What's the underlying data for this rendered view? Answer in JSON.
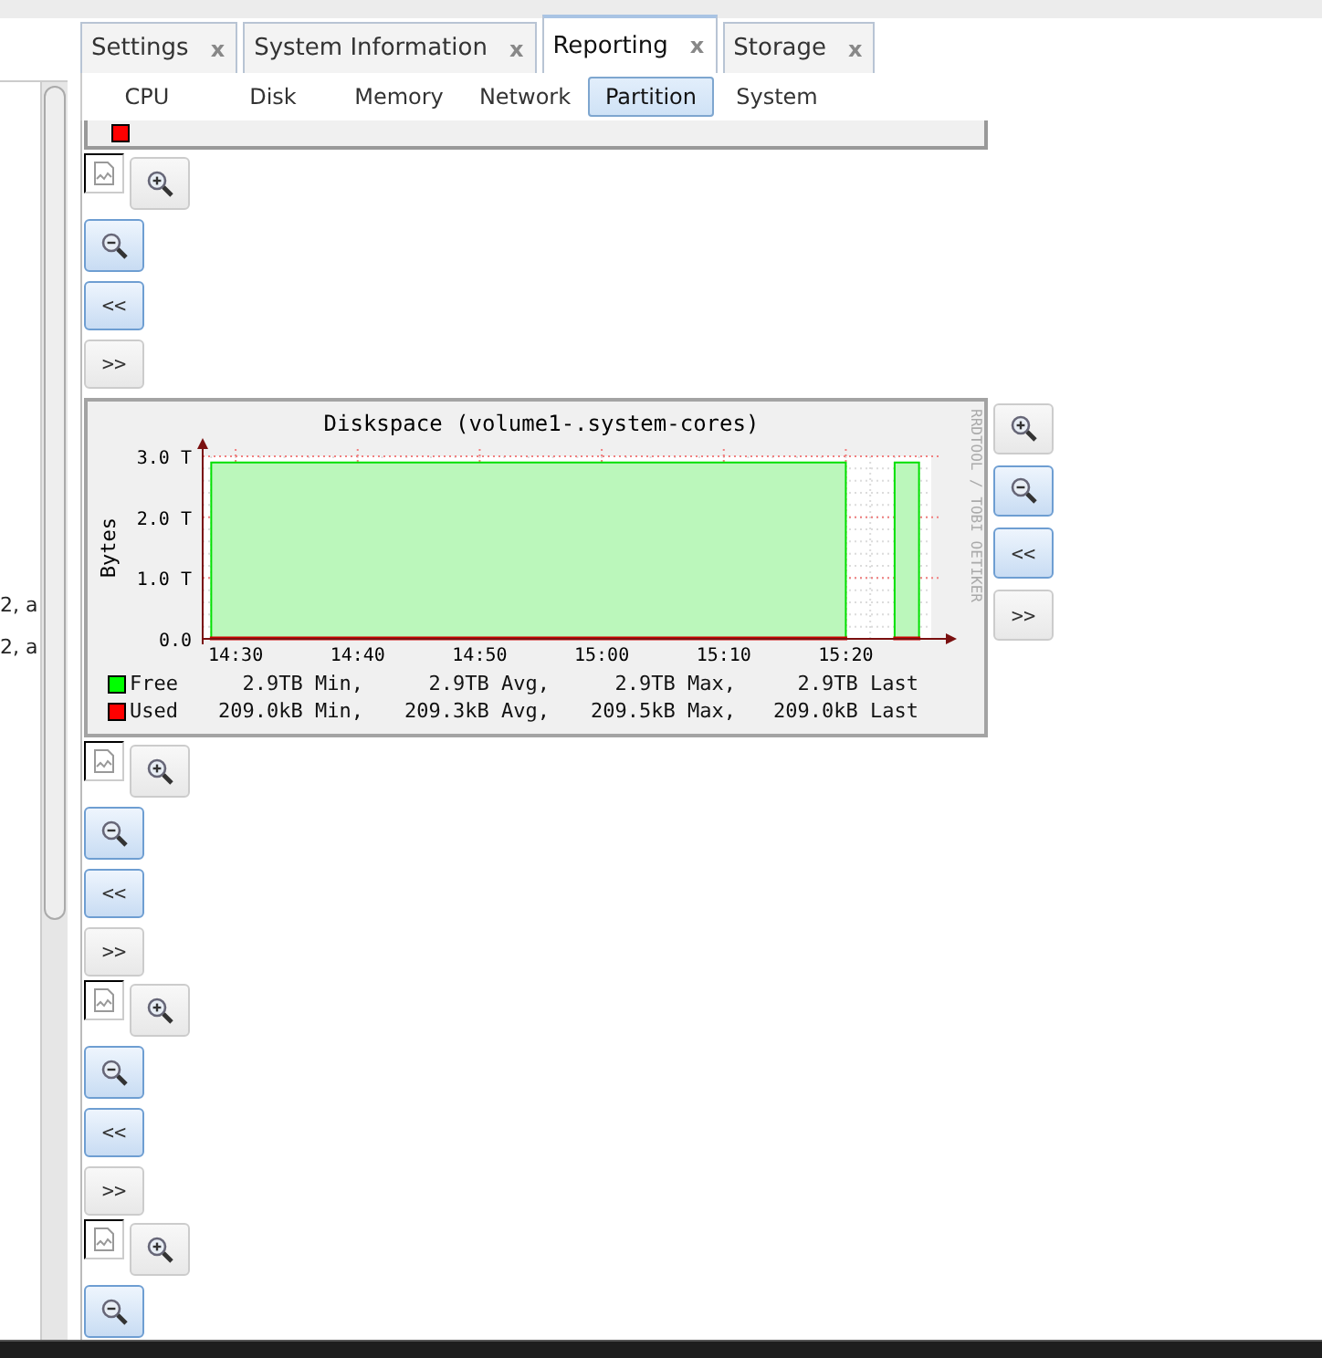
{
  "left_panel": {
    "lines": [
      "2, a",
      "2, a"
    ]
  },
  "tabs": [
    {
      "label": "Settings",
      "close": "x",
      "selected": false
    },
    {
      "label": "System Information",
      "close": "x",
      "selected": false
    },
    {
      "label": "Reporting",
      "close": "x",
      "selected": true
    },
    {
      "label": "Storage",
      "close": "x",
      "selected": false
    }
  ],
  "subtabs": [
    {
      "label": "CPU",
      "selected": false
    },
    {
      "label": "Disk",
      "selected": false
    },
    {
      "label": "Memory",
      "selected": false
    },
    {
      "label": "Network",
      "selected": false
    },
    {
      "label": "Partition",
      "selected": true
    },
    {
      "label": "System",
      "selected": false
    }
  ],
  "blocks": [
    {
      "kind": "cut"
    },
    {
      "kind": "broken",
      "buttons": [
        {
          "kind": "zoom-in",
          "selected": false
        },
        {
          "kind": "zoom-out",
          "selected": true
        },
        {
          "kind": "text",
          "label": "<<",
          "selected": true
        },
        {
          "kind": "text",
          "label": ">>",
          "selected": false
        }
      ]
    },
    {
      "kind": "graph",
      "graph": {
        "credit": "RRDTOOL / TOBI OETIKER",
        "legend": [
          {
            "color": "#00ff00",
            "stats": [
              "2.9TB Min,",
              "2.9TB Avg,",
              "2.9TB Max,",
              "2.9TB Last"
            ]
          },
          {
            "color": "#ff0000",
            "stats": [
              "209.0kB Min,",
              "209.3kB Avg,",
              "209.5kB Max,",
              "209.0kB Last"
            ]
          }
        ],
        "chart_data": {
          "type": "area",
          "title": "Diskspace (volume1-.system-cores)",
          "ylabel": "Bytes",
          "categories": [
            null,
            "14:30",
            null,
            null,
            null,
            null,
            "14:40",
            null,
            null,
            null,
            null,
            "14:50",
            null,
            null,
            null,
            null,
            "15:00",
            null,
            null,
            null,
            null,
            "15:10",
            null,
            null,
            null,
            null,
            "15:20",
            null,
            null,
            null
          ],
          "series": [
            {
              "name": "Free",
              "color": "#00e000",
              "values": [
                2.9,
                2.9,
                2.9,
                2.9,
                2.9,
                2.9,
                2.9,
                2.9,
                2.9,
                2.9,
                2.9,
                2.9,
                2.9,
                2.9,
                2.9,
                2.9,
                2.9,
                2.9,
                2.9,
                2.9,
                2.9,
                2.9,
                2.9,
                2.9,
                2.9,
                2.9,
                2.9,
                null,
                2.9,
                2.9
              ]
            },
            {
              "name": "Used",
              "color": "#cc0000",
              "values": [
                0,
                0,
                0,
                0,
                0,
                0,
                0,
                0,
                0,
                0,
                0,
                0,
                0,
                0,
                0,
                0,
                0,
                0,
                0,
                0,
                0,
                0,
                0,
                0,
                0,
                0,
                0,
                null,
                0,
                0
              ]
            }
          ],
          "ylim": [
            0,
            3
          ],
          "grid": true,
          "yticks": [
            {
              "value": 0,
              "label": "0.0"
            },
            {
              "value": 1,
              "label": "1.0 T"
            },
            {
              "value": 2,
              "label": "2.0 T"
            },
            {
              "value": 3,
              "label": "3.0 T"
            }
          ]
        }
      },
      "buttons": [
        {
          "kind": "zoom-in",
          "selected": false
        },
        {
          "kind": "zoom-out",
          "selected": true
        },
        {
          "kind": "text",
          "label": "<<",
          "selected": true
        },
        {
          "kind": "text",
          "label": ">>",
          "selected": false
        }
      ]
    },
    {
      "kind": "broken",
      "buttons": [
        {
          "kind": "zoom-in",
          "selected": false
        },
        {
          "kind": "zoom-out",
          "selected": true
        },
        {
          "kind": "text",
          "label": "<<",
          "selected": true
        },
        {
          "kind": "text",
          "label": ">>",
          "selected": false
        }
      ]
    },
    {
      "kind": "broken",
      "buttons": [
        {
          "kind": "zoom-in",
          "selected": false
        },
        {
          "kind": "zoom-out",
          "selected": true
        },
        {
          "kind": "text",
          "label": "<<",
          "selected": true
        },
        {
          "kind": "text",
          "label": ">>",
          "selected": false
        }
      ]
    },
    {
      "kind": "broken",
      "buttons": [
        {
          "kind": "zoom-in",
          "selected": false
        },
        {
          "kind": "zoom-out",
          "selected": true
        }
      ]
    }
  ]
}
